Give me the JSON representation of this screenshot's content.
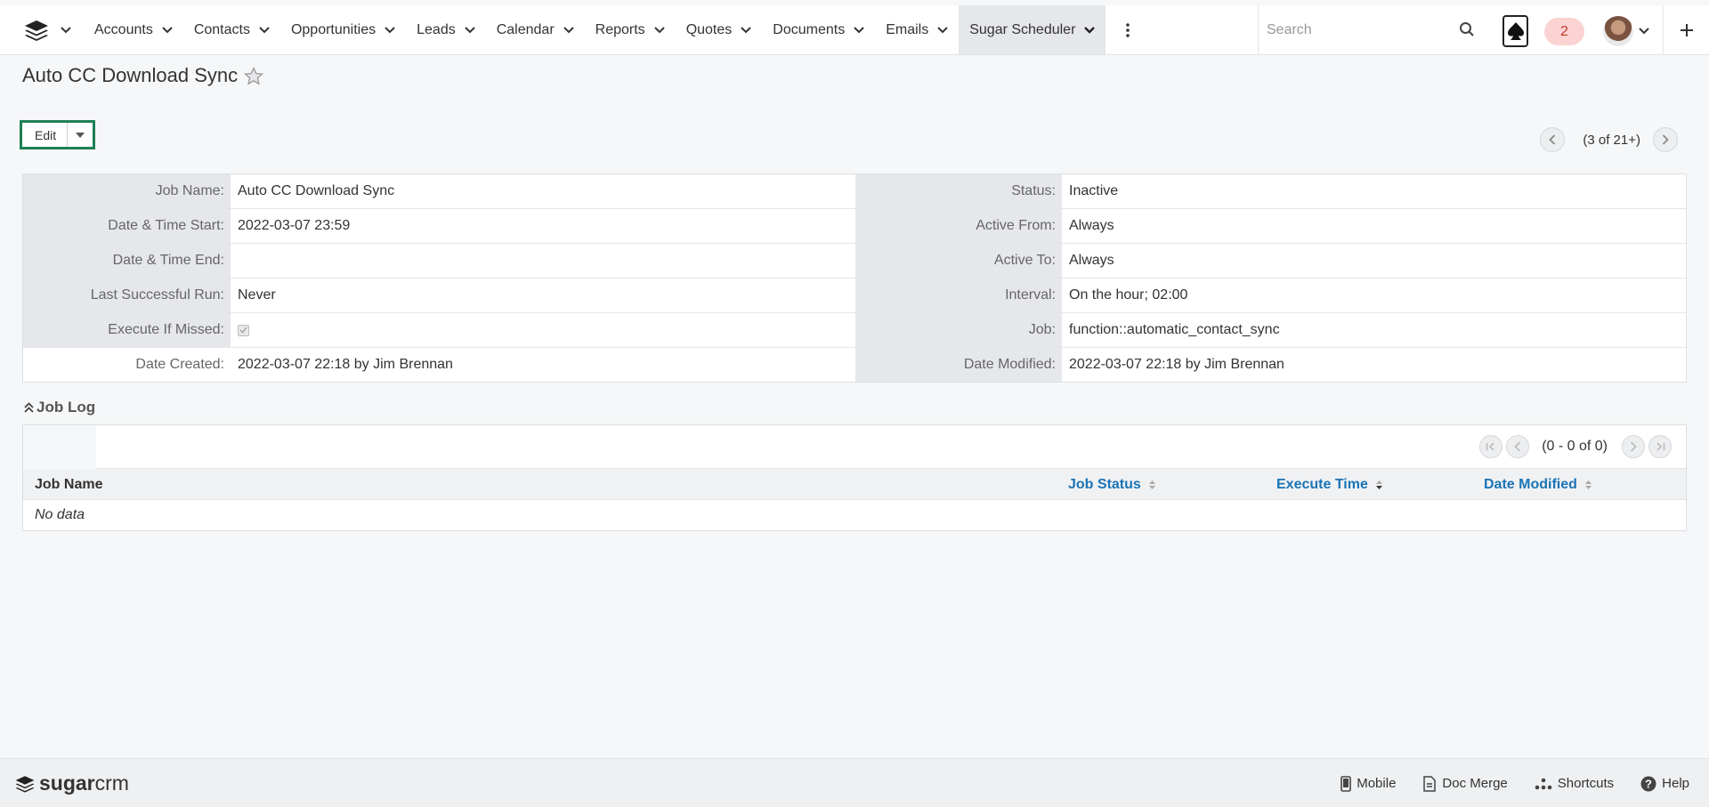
{
  "nav": {
    "items": [
      {
        "label": "Accounts"
      },
      {
        "label": "Contacts"
      },
      {
        "label": "Opportunities"
      },
      {
        "label": "Leads"
      },
      {
        "label": "Calendar"
      },
      {
        "label": "Reports"
      },
      {
        "label": "Quotes"
      },
      {
        "label": "Documents"
      },
      {
        "label": "Emails"
      },
      {
        "label": "Sugar Scheduler"
      }
    ],
    "active": "Sugar Scheduler",
    "search_placeholder": "Search",
    "notification_count": "2"
  },
  "record": {
    "title": "Auto CC Download Sync",
    "edit_label": "Edit",
    "pager_count": "(3 of 21+)"
  },
  "details": {
    "rows": [
      {
        "left_label": "Job Name:",
        "left_value": "Auto CC Download Sync",
        "right_label": "Status:",
        "right_value": "Inactive"
      },
      {
        "left_label": "Date & Time Start:",
        "left_value": "2022-03-07 23:59",
        "right_label": "Active From:",
        "right_value": "Always"
      },
      {
        "left_label": "Date & Time End:",
        "left_value": "",
        "right_label": "Active To:",
        "right_value": "Always"
      },
      {
        "left_label": "Last Successful Run:",
        "left_value": "Never",
        "right_label": "Interval:",
        "right_value": "On the hour; 02:00"
      },
      {
        "left_label": "Execute If Missed:",
        "left_value": "",
        "right_label": "Job:",
        "right_value": "function::automatic_contact_sync"
      },
      {
        "left_label": "Date Created:",
        "left_value": "2022-03-07 22:18 by Jim Brennan",
        "right_label": "Date Modified:",
        "right_value": "2022-03-07 22:18 by Jim Brennan"
      }
    ],
    "execute_if_missed_checked": true
  },
  "job_log": {
    "title": "Job Log",
    "pager_count": "(0 - 0 of 0)",
    "columns": [
      "Job Name",
      "Job Status",
      "Execute Time",
      "Date Modified"
    ],
    "empty_text": "No data"
  },
  "footer": {
    "brand_a": "sugar",
    "brand_b": "crm",
    "links": [
      "Mobile",
      "Doc Merge",
      "Shortcuts",
      "Help"
    ]
  },
  "colors": {
    "accent_green": "#1e7f55",
    "link_blue": "#1a74b5",
    "notif_bg": "#fbd3d3",
    "label_bg": "#e5e7ea"
  }
}
